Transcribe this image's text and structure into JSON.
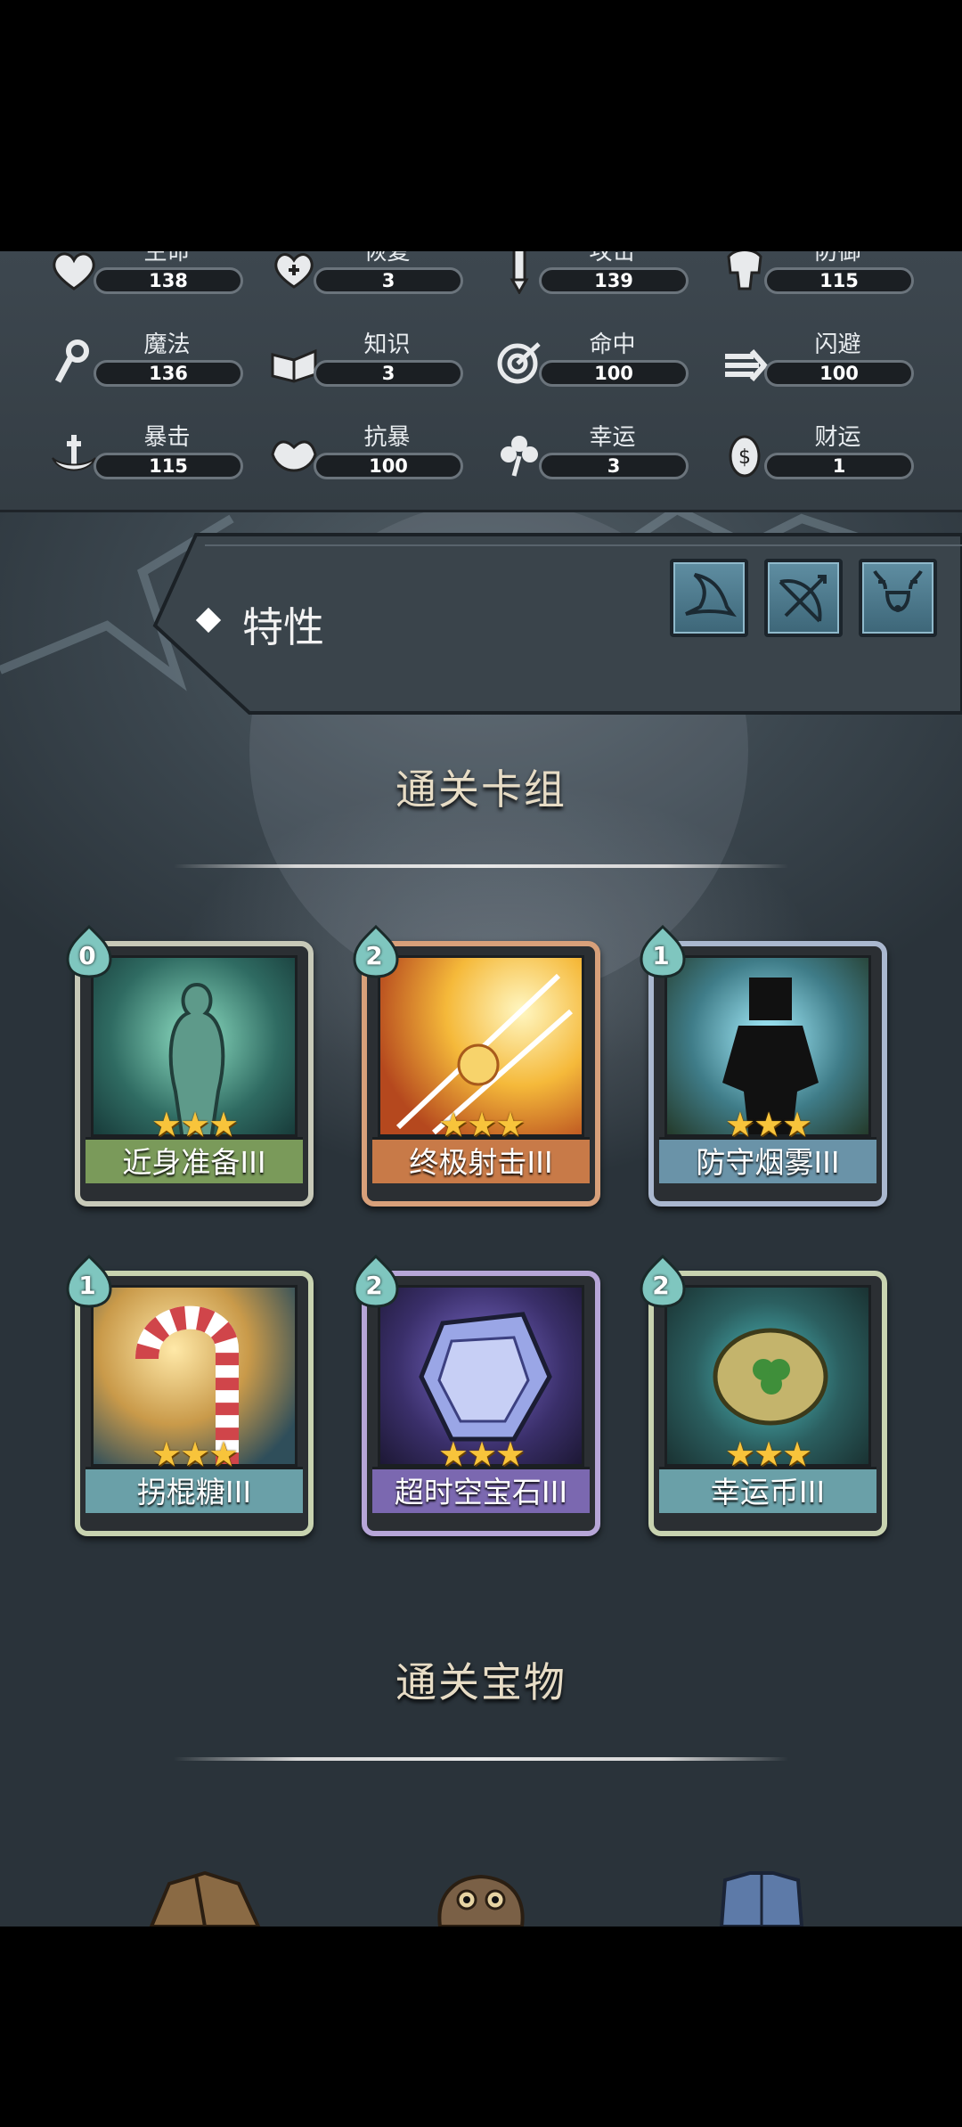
{
  "stats": [
    {
      "label": "生命",
      "value": "138",
      "icon": "heart-icon"
    },
    {
      "label": "恢复",
      "value": "3",
      "icon": "heart-plus-icon"
    },
    {
      "label": "攻击",
      "value": "139",
      "icon": "sword-icon"
    },
    {
      "label": "防御",
      "value": "115",
      "icon": "armor-icon"
    },
    {
      "label": "魔法",
      "value": "136",
      "icon": "staff-icon"
    },
    {
      "label": "知识",
      "value": "3",
      "icon": "book-icon"
    },
    {
      "label": "命中",
      "value": "100",
      "icon": "target-icon"
    },
    {
      "label": "闪避",
      "value": "100",
      "icon": "dodge-icon"
    },
    {
      "label": "暴击",
      "value": "115",
      "icon": "crit-icon"
    },
    {
      "label": "抗暴",
      "value": "100",
      "icon": "crit-resist-icon"
    },
    {
      "label": "幸运",
      "value": "3",
      "icon": "clover-icon"
    },
    {
      "label": "财运",
      "value": "1",
      "icon": "coin-icon"
    }
  ],
  "trait": {
    "label": "特性",
    "buttons": [
      "hat-icon",
      "bow-icon",
      "reindeer-icon"
    ]
  },
  "deck_section": {
    "title": "通关卡组"
  },
  "cards": [
    {
      "name": "近身准备III",
      "cost": "0",
      "stars": "★★★",
      "theme": "#5a8a72",
      "name_bg": "#7a9a5a",
      "frame": "#c7c9b8"
    },
    {
      "name": "终极射击III",
      "cost": "2",
      "stars": "★★★",
      "theme": "#e8a23a",
      "name_bg": "#c87a48",
      "frame": "#d8a07a"
    },
    {
      "name": "防守烟雾III",
      "cost": "1",
      "stars": "★★★",
      "theme": "#4c7f8a",
      "name_bg": "#6a93a8",
      "frame": "#aab8cf"
    },
    {
      "name": "拐棍糖III",
      "cost": "1",
      "stars": "★★★",
      "theme": "#c79a4a",
      "name_bg": "#6aa0a8",
      "frame": "#c8d3b0"
    },
    {
      "name": "超时空宝石III",
      "cost": "2",
      "stars": "★★★",
      "theme": "#4a3f7a",
      "name_bg": "#7b68b0",
      "frame": "#b7a6d8"
    },
    {
      "name": "幸运币III",
      "cost": "2",
      "stars": "★★★",
      "theme": "#2f6d6e",
      "name_bg": "#6aa0a8",
      "frame": "#c8d3b0"
    }
  ],
  "treasure_section": {
    "title": "通关宝物"
  },
  "treasures": [
    "coat-icon",
    "owl-icon",
    "chestplate-icon"
  ]
}
